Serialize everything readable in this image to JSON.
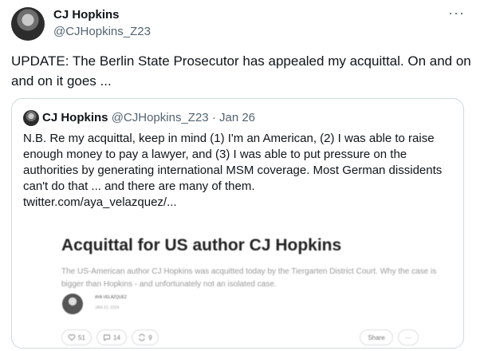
{
  "tweet": {
    "author_name": "CJ Hopkins",
    "author_handle": "@CJHopkins_Z23",
    "more_label": "···",
    "text": "UPDATE: The Berlin State Prosecutor has appealed my acquittal. On and on and on it goes ..."
  },
  "quote": {
    "author_name": "CJ Hopkins",
    "author_handle": "@CJHopkins_Z23",
    "separator": "·",
    "date": "Jan 26",
    "text": "N.B. Re my acquittal, keep in mind (1) I'm an American, (2) I was able to raise enough money to pay a lawyer, and (3) I was able to put pressure on the authorities by generating international MSM coverage. Most German dissidents can't do that ... and there are many of them.",
    "link": "twitter.com/aya_velazquez/..."
  },
  "article": {
    "title": "Acquittal for US author CJ Hopkins",
    "subtitle": "The US-American author CJ Hopkins was acquitted today by the Tiergarten District Court. Why the case is bigger than Hopkins - and unfortunately not an isolated case.",
    "author": "AYA VELÁZQUEZ",
    "date": "JAN 23, 2024",
    "likes": "51",
    "comments": "14",
    "restacks": "9",
    "share_label": "Share",
    "more_label": "···"
  },
  "icons": [
    "heart-icon",
    "comment-icon",
    "restack-icon"
  ]
}
